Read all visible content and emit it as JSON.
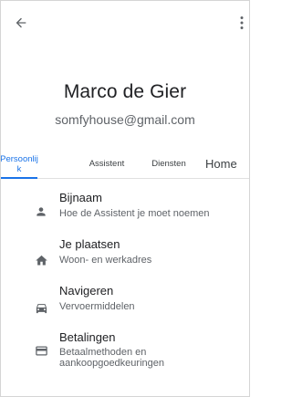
{
  "profile": {
    "name": "Marco de Gier",
    "email": "somfyhouse@gmail.com"
  },
  "tabs": [
    {
      "label_line1": "Persoonlij",
      "label_line2": "k",
      "active": true
    },
    {
      "label": "Assistent"
    },
    {
      "label": "Diensten"
    },
    {
      "label": "Home"
    }
  ],
  "items": [
    {
      "title": "Bijnaam",
      "subtitle": "Hoe de Assistent je moet noemen",
      "icon": "person-icon"
    },
    {
      "title": "Je plaatsen",
      "subtitle": "Woon- en werkadres",
      "icon": "home-icon"
    },
    {
      "title": "Navigeren",
      "subtitle": "Vervoermiddelen",
      "icon": "car-icon"
    },
    {
      "title": "Betalingen",
      "subtitle_line1": "Betaalmethoden en",
      "subtitle_line2": "aankoopgoedkeuringen",
      "icon": "credit-card-icon"
    }
  ],
  "colors": {
    "accent": "#1a73e8",
    "icon": "#5f6368",
    "text_primary": "#202124",
    "text_secondary": "#5f6368"
  }
}
